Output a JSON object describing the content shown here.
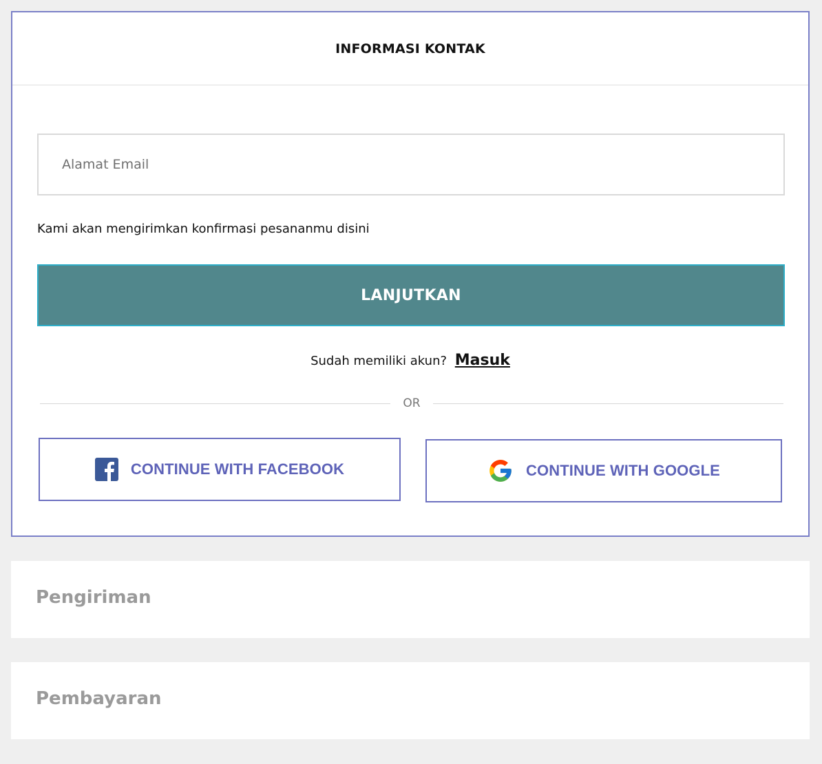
{
  "contact": {
    "title": "INFORMASI KONTAK",
    "email_placeholder": "Alamat Email",
    "helper_text": "Kami akan mengirimkan konfirmasi pesananmu disini",
    "continue_label": "LANJUTKAN",
    "login_prompt": "Sudah memiliki akun?",
    "login_link": "Masuk",
    "divider_text": "OR",
    "facebook_label": "CONTINUE WITH FACEBOOK",
    "google_label": "CONTINUE WITH GOOGLE"
  },
  "sections": {
    "shipping": "Pengiriman",
    "payment": "Pembayaran"
  },
  "icons": {
    "facebook": "facebook-icon",
    "google": "google-icon"
  },
  "colors": {
    "card_border": "#7a7fc8",
    "continue_button": "#51878c",
    "continue_border": "#2eaec8",
    "social_text": "#5e63b8",
    "facebook_blue": "#3b5998",
    "section_title": "#9a9a9a",
    "background": "#efefef"
  }
}
